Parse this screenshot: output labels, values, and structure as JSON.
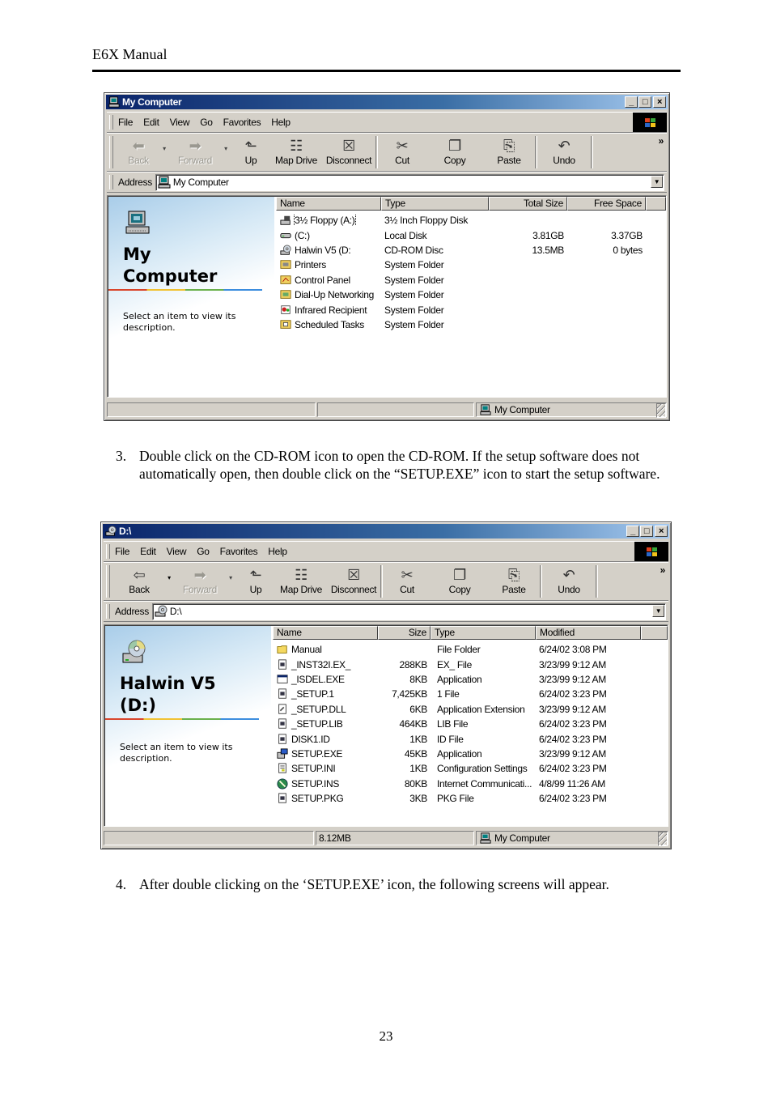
{
  "doc": {
    "header": "E6X Manual",
    "page_number": "23",
    "steps": [
      {
        "num": "3.",
        "text": "Double click on the CD-ROM icon to open the CD-ROM. If the setup software does not automatically open, then double click on the “SETUP.EXE” icon to start the setup software."
      },
      {
        "num": "4.",
        "text": "After double clicking on the ‘SETUP.EXE’ icon, the following screens will appear."
      }
    ]
  },
  "window1": {
    "title": "My Computer",
    "title_icon": "computer-icon",
    "controls": {
      "minimize": "_",
      "maximize": "□",
      "close": "×"
    },
    "menu": [
      "File",
      "Edit",
      "View",
      "Go",
      "Favorites",
      "Help"
    ],
    "toolbar": [
      {
        "label": "Back",
        "icon": "back-arrow-icon",
        "glyph": "⬅",
        "disabled": true
      },
      {
        "label": "Forward",
        "icon": "forward-arrow-icon",
        "glyph": "➡",
        "disabled": true
      },
      {
        "label": "Up",
        "icon": "up-folder-icon",
        "glyph": "⬑"
      },
      {
        "label": "Map Drive",
        "icon": "map-drive-icon",
        "glyph": "☷"
      },
      {
        "label": "Disconnect",
        "icon": "disconnect-icon",
        "glyph": "☒"
      },
      {
        "label": "Cut",
        "icon": "scissors-icon",
        "glyph": "✂"
      },
      {
        "label": "Copy",
        "icon": "copy-icon",
        "glyph": "❐"
      },
      {
        "label": "Paste",
        "icon": "paste-icon",
        "glyph": "⎘"
      },
      {
        "label": "Undo",
        "icon": "undo-icon",
        "glyph": "↶"
      }
    ],
    "chevron": "»",
    "address_label": "Address",
    "address_value": "My Computer",
    "panel": {
      "title_line1": "My",
      "title_line2": "Computer",
      "description": "Select an item to view its description."
    },
    "columns": [
      "Name",
      "Type",
      "Total Size",
      "Free Space"
    ],
    "items": [
      {
        "name": "3½ Floppy (A:)",
        "type": "3½ Inch Floppy Disk",
        "total": "",
        "free": "",
        "icon": "floppy-drive-icon"
      },
      {
        "name": "(C:)",
        "type": "Local Disk",
        "total": "3.81GB",
        "free": "3.37GB",
        "icon": "hard-drive-icon"
      },
      {
        "name": "Halwin V5 (D:",
        "type": "CD-ROM Disc",
        "total": "13.5MB",
        "free": "0 bytes",
        "icon": "cd-drive-icon"
      },
      {
        "name": "Printers",
        "type": "System Folder",
        "total": "",
        "free": "",
        "icon": "printers-folder-icon"
      },
      {
        "name": "Control Panel",
        "type": "System Folder",
        "total": "",
        "free": "",
        "icon": "control-panel-icon"
      },
      {
        "name": "Dial-Up Networking",
        "type": "System Folder",
        "total": "",
        "free": "",
        "icon": "dialup-networking-icon"
      },
      {
        "name": "Infrared Recipient",
        "type": "System Folder",
        "total": "",
        "free": "",
        "icon": "infrared-icon"
      },
      {
        "name": "Scheduled Tasks",
        "type": "System Folder",
        "total": "",
        "free": "",
        "icon": "scheduled-tasks-icon"
      }
    ],
    "status": {
      "left": "",
      "middle": "",
      "right": "My Computer"
    }
  },
  "window2": {
    "title": "D:\\",
    "title_icon": "cd-drive-icon",
    "controls": {
      "minimize": "_",
      "maximize": "□",
      "close": "×"
    },
    "menu": [
      "File",
      "Edit",
      "View",
      "Go",
      "Favorites",
      "Help"
    ],
    "toolbar": [
      {
        "label": "Back",
        "icon": "back-arrow-icon",
        "glyph": "⇦",
        "disabled": false
      },
      {
        "label": "Forward",
        "icon": "forward-arrow-icon",
        "glyph": "➡",
        "disabled": true
      },
      {
        "label": "Up",
        "icon": "up-folder-icon",
        "glyph": "⬑"
      },
      {
        "label": "Map Drive",
        "icon": "map-drive-icon",
        "glyph": "☷"
      },
      {
        "label": "Disconnect",
        "icon": "disconnect-icon",
        "glyph": "☒"
      },
      {
        "label": "Cut",
        "icon": "scissors-icon",
        "glyph": "✂"
      },
      {
        "label": "Copy",
        "icon": "copy-icon",
        "glyph": "❐"
      },
      {
        "label": "Paste",
        "icon": "paste-icon",
        "glyph": "⎘"
      },
      {
        "label": "Undo",
        "icon": "undo-icon",
        "glyph": "↶"
      }
    ],
    "chevron": "»",
    "address_label": "Address",
    "address_value": "D:\\",
    "panel": {
      "title_line1": "Halwin V5",
      "title_line2": "(D:)",
      "description": "Select an item to view its description."
    },
    "columns": [
      "Name",
      "Size",
      "Type",
      "Modified"
    ],
    "items": [
      {
        "name": "Manual",
        "size": "",
        "type": "File Folder",
        "modified": "6/24/02 3:08 PM",
        "icon": "folder-icon"
      },
      {
        "name": "_INST32I.EX_",
        "size": "288KB",
        "type": "EX_ File",
        "modified": "3/23/99 9:12 AM",
        "icon": "file-icon"
      },
      {
        "name": "_ISDEL.EXE",
        "size": "8KB",
        "type": "Application",
        "modified": "3/23/99 9:12 AM",
        "icon": "application-icon"
      },
      {
        "name": "_SETUP.1",
        "size": "7,425KB",
        "type": "1 File",
        "modified": "6/24/02 3:23 PM",
        "icon": "file-icon"
      },
      {
        "name": "_SETUP.DLL",
        "size": "6KB",
        "type": "Application Extension",
        "modified": "3/23/99 9:12 AM",
        "icon": "dll-icon"
      },
      {
        "name": "_SETUP.LIB",
        "size": "464KB",
        "type": "LIB File",
        "modified": "6/24/02 3:23 PM",
        "icon": "file-icon"
      },
      {
        "name": "DISK1.ID",
        "size": "1KB",
        "type": "ID File",
        "modified": "6/24/02 3:23 PM",
        "icon": "file-icon"
      },
      {
        "name": "SETUP.EXE",
        "size": "45KB",
        "type": "Application",
        "modified": "3/23/99 9:12 AM",
        "icon": "setup-exe-icon"
      },
      {
        "name": "SETUP.INI",
        "size": "1KB",
        "type": "Configuration Settings",
        "modified": "6/24/02 3:23 PM",
        "icon": "config-file-icon"
      },
      {
        "name": "SETUP.INS",
        "size": "80KB",
        "type": "Internet Communicati...",
        "modified": "4/8/99 11:26 AM",
        "icon": "internet-file-icon"
      },
      {
        "name": "SETUP.PKG",
        "size": "3KB",
        "type": "PKG File",
        "modified": "6/24/02 3:23 PM",
        "icon": "file-icon"
      }
    ],
    "status": {
      "left": "",
      "middle": "8.12MB",
      "right": "My Computer"
    }
  }
}
